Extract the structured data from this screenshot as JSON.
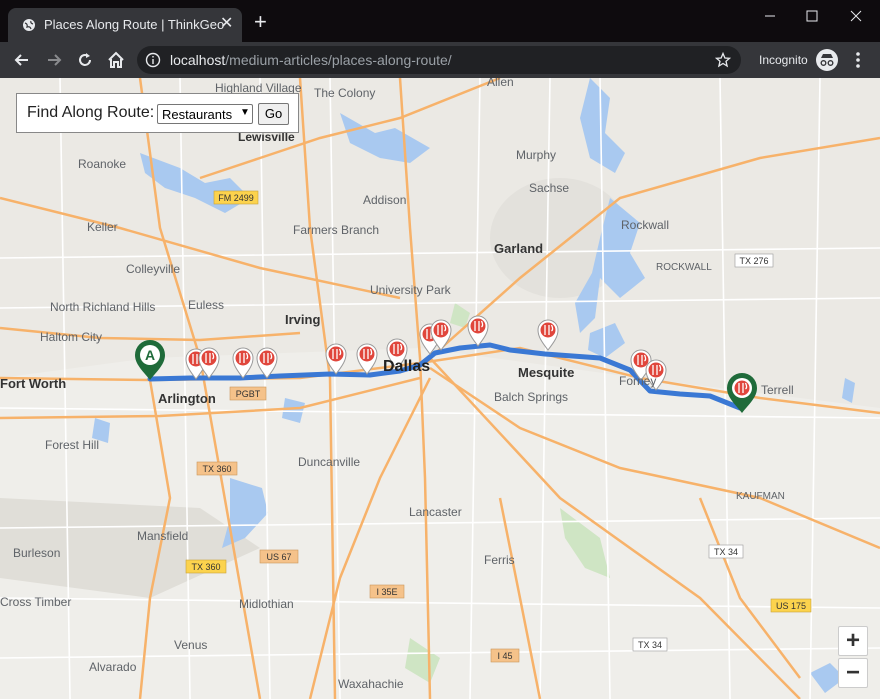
{
  "browser": {
    "tab_title": "Places Along Route | ThinkGeo",
    "url_host": "localhost",
    "url_path": "/medium-articles/places-along-route/",
    "incognito_label": "Incognito"
  },
  "panel": {
    "label": "Find Along Route:",
    "selected_category": "Restaurants",
    "go_label": "Go"
  },
  "map": {
    "places": [
      "Highland Village",
      "The Colony",
      "Lewisville",
      "Roanoke",
      "Murphy",
      "Sachse",
      "Addison",
      "Keller",
      "Farmers Branch",
      "Garland",
      "Rockwall",
      "Colleyville",
      "University Park",
      "North Richland Hills",
      "Euless",
      "Irving",
      "Haltom City",
      "Dallas",
      "Mesquite",
      "Fort Worth",
      "Arlington",
      "Balch Springs",
      "Forney",
      "Terrell",
      "Forest Hill",
      "Duncanville",
      "Kaufman",
      "Lancaster",
      "Mansfield",
      "Burleson",
      "Ferris",
      "Cross Timber",
      "Midlothian",
      "Alvarado",
      "Venus",
      "Waxahachie",
      "Allen"
    ],
    "place_labels": {
      "highland_village": "Highland Village",
      "the_colony": "The Colony",
      "lewisville": "Lewisville",
      "roanoke": "Roanoke",
      "murphy": "Murphy",
      "sachse": "Sachse",
      "addison": "Addison",
      "keller": "Keller",
      "farmers_branch": "Farmers Branch",
      "garland": "Garland",
      "rockwall": "Rockwall",
      "rockwall_county": "ROCKWALL",
      "colleyville": "Colleyville",
      "university_park": "University Park",
      "north_richland_hills": "North Richland Hills",
      "euless": "Euless",
      "irving": "Irving",
      "haltom_city": "Haltom City",
      "dallas": "Dallas",
      "mesquite": "Mesquite",
      "fort_worth": "Fort Worth",
      "arlington": "Arlington",
      "balch_springs": "Balch Springs",
      "forney": "Forney",
      "terrell": "Terrell",
      "forest_hill": "Forest Hill",
      "duncanville": "Duncanville",
      "kaufman": "KAUFMAN",
      "lancaster": "Lancaster",
      "mansfield": "Mansfield",
      "burleson": "Burleson",
      "ferris": "Ferris",
      "cross_timber": "Cross Timber",
      "midlothian": "Midlothian",
      "alvarado": "Alvarado",
      "venus": "Venus",
      "waxahachie": "Waxahachie",
      "allen": "Allen"
    },
    "shields": {
      "fm2499": "FM 2499",
      "pgbt": "PGBT",
      "tx360a": "TX 360",
      "tx360b": "TX 360",
      "us67": "US 67",
      "tx276": "TX 276",
      "tx34a": "TX 34",
      "tx34b": "TX 34",
      "i35e": "I 35E",
      "i45": "I 45",
      "us175": "US 175"
    },
    "start_marker": "A",
    "zoom_in": "+",
    "zoom_out": "−",
    "colors": {
      "route": "#3a78d4",
      "marker_green": "#1f6b3a",
      "restaurant_pin": "#e0463c",
      "water": "#a9c9f0",
      "highway": "#f7b26a"
    }
  }
}
